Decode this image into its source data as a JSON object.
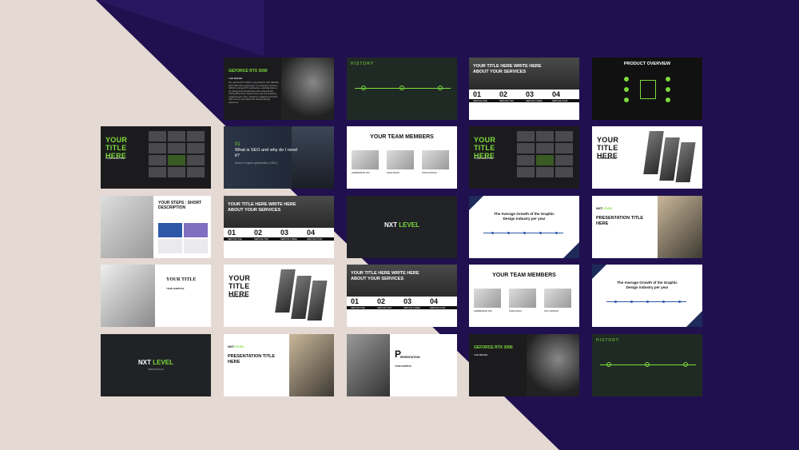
{
  "colors": {
    "bg_left": "#e5dad4",
    "bg_right": "#1f0e4e",
    "accent": "#7ddc3c"
  },
  "slides": {
    "r1c1": {
      "title": "GEFORCE RTX 3090",
      "subtitle": "THE BRAND",
      "body": "The GeForce RTX 3090 is a big ferocious GPU (BFGPU) with TITAN class performance. It's powered by Ampere—NVIDIA's 2nd gen RTX architecture—doubling down on ray tracing and AI performance with enhanced Ray Tracing (RT) Cores, Tensor Cores, and new streaming multiprocessors. Plus, it features a staggering 24 GB of G6X memory, all to deliver the ultimate gaming experience."
    },
    "r1c2": {
      "title": "HISTORY"
    },
    "r1c3": {
      "title": "YOUR TITLE HERE WRITE HERE ABOUT YOUR SERVICES",
      "n1": "01",
      "n2": "02",
      "n3": "03",
      "n4": "04",
      "s1": "SERVICE ONE",
      "s2": "SERVICE TWO",
      "s3": "SERVICE THREE",
      "s4": "SERVICE FOUR"
    },
    "r1c4": {
      "title": "PRODUCT OVERVIEW"
    },
    "r2c1": {
      "title": "YOUR TITLE HERE",
      "subtitle": "YOUR SUBTITLE"
    },
    "r2c2": {
      "num": "01",
      "title": "What is SEO and why do I need it?",
      "body": "Search engine optimization (SEO)"
    },
    "r2c3": {
      "title": "YOUR TEAM MEMBERS",
      "m1": "ANDREWSON KIM",
      "m2": "LINDA DAVIS",
      "m3": "KATE HUDSON"
    },
    "r2c4": {
      "title": "YOUR TITLE HERE",
      "subtitle": "YOUR SUBTITLE"
    },
    "r2c5": {
      "title": "YOUR TITLE HERE",
      "subtitle": "YOUR SUBTITLE"
    },
    "r3c1": {
      "title": "YOUR STEPS : SHORT DESCRIPTION"
    },
    "r3c2": {
      "title": "YOUR TITLE HERE WRITE HERE ABOUT YOUR SERVICES",
      "n1": "01",
      "n2": "02",
      "n3": "03",
      "n4": "04",
      "s1": "SERVICE ONE",
      "s2": "SERVICE TWO",
      "s3": "SERVICE THREE",
      "s4": "SERVICE FOUR"
    },
    "r3c3": {
      "logo_a": "NXT",
      "logo_b": "LEVEL"
    },
    "r3c4": {
      "title": "The Average Growth of the Graphic Design industry per year"
    },
    "r3c5": {
      "logo_a": "NXT",
      "logo_b": "LEVEL",
      "title": "PRESENTATION TITLE HERE"
    },
    "r4c1": {
      "title": "YOUR TITLE",
      "subtitle": "YOUR SUBTITLE"
    },
    "r4c2": {
      "title": "YOUR TITLE HERE",
      "subtitle": "YOUR SUBTITLE"
    },
    "r4c3": {
      "title": "YOUR TITLE HERE WRITE HERE ABOUT YOUR SERVICES",
      "n1": "01",
      "n2": "02",
      "n3": "03",
      "n4": "04",
      "s1": "SERVICE ONE",
      "s2": "SERVICE TWO",
      "s3": "SERVICE THREE",
      "s4": "SERVICE FOUR"
    },
    "r4c4": {
      "title": "YOUR TEAM MEMBERS",
      "m1": "ANDREWSON KIM",
      "m2": "LINDA DAVIS",
      "m3": "KAT LARSSON"
    },
    "r4c5": {
      "title": "The Average Growth of the Graphic Design industry per year"
    },
    "r5c1": {
      "logo_a": "NXT",
      "logo_b": "LEVEL",
      "sub": "PRESENTATION"
    },
    "r5c2": {
      "logo_a": "NXT",
      "logo_b": "LEVEL",
      "title": "PRESENTATION TITLE HERE"
    },
    "r5c3": {
      "big": "P",
      "title": "RESENTATION",
      "subtitle": "YOUR SUBTITLE"
    },
    "r5c4": {
      "title": "GEFORCE RTX 3090",
      "subtitle": "THE BRAND"
    },
    "r5c5": {
      "title": "HISTORY"
    }
  }
}
